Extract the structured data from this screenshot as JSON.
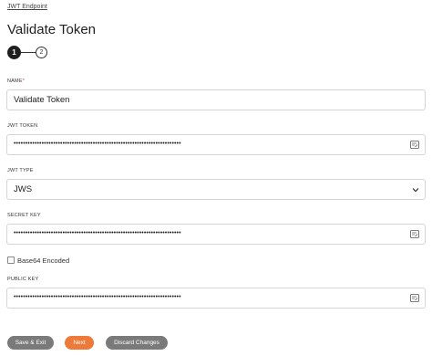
{
  "breadcrumb": "JWT Endpoint",
  "page_title": "Validate Token",
  "steps": [
    "1",
    "2"
  ],
  "form": {
    "name": {
      "label": "NAME",
      "required_marker": "*",
      "value": "Validate Token"
    },
    "jwt_token": {
      "label": "JWT TOKEN",
      "value": "••••••••••••••••••••••••••••••••••••••••••••••••••••••••••••••••••••••••"
    },
    "jwt_type": {
      "label": "JWT TYPE",
      "value": "JWS"
    },
    "secret_key": {
      "label": "SECRET KEY",
      "value": "••••••••••••••••••••••••••••••••••••••••••••••••••••••••••••••••••••••••"
    },
    "base64": {
      "label": "Base64 Encoded",
      "checked": false
    },
    "public_key": {
      "label": "PUBLIC KEY",
      "value": "••••••••••••••••••••••••••••••••••••••••••••••••••••••••••••••••••••••••"
    }
  },
  "buttons": {
    "save_exit": "Save & Exit",
    "next": "Next",
    "discard": "Discard Changes"
  },
  "colors": {
    "next_button": "#ee7a3a",
    "secondary_button": "#7a7a7a",
    "active_step": "#1f1f1f",
    "required": "#d0382c"
  },
  "icons": {
    "token_field": "edit-document-icon",
    "secret_key_field": "edit-document-icon",
    "public_key_field": "edit-document-icon",
    "jwt_type_dropdown": "chevron-down-icon"
  }
}
